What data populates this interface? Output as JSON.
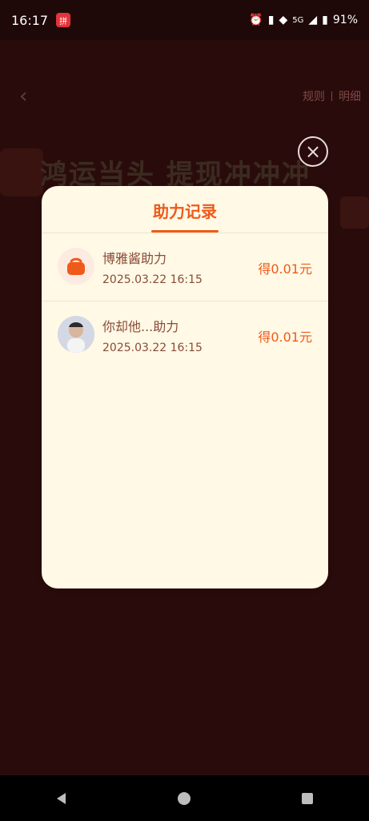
{
  "status_bar": {
    "time": "16:17",
    "network": "5G",
    "battery": "91%"
  },
  "background": {
    "header_links": {
      "rules": "规则",
      "details": "明细"
    },
    "banner_title": "鸿运当头 提现冲冲冲"
  },
  "modal": {
    "title": "助力记录",
    "records": [
      {
        "name": "博雅酱助力",
        "time": "2025.03.22 16:15",
        "amount": "得0.01元",
        "avatar": "bag"
      },
      {
        "name": "你却他...助力",
        "time": "2025.03.22 16:15",
        "amount": "得0.01元",
        "avatar": "person-photo"
      }
    ]
  },
  "colors": {
    "accent": "#ef5a1a",
    "modal_bg": "#fff9e6",
    "text_brown": "#8a4b35",
    "overlay_bg": "#2a0b0b"
  },
  "icons": {
    "back": "back-chevron-icon",
    "close": "close-icon",
    "nav_back": "nav-back-icon",
    "nav_home": "nav-home-icon",
    "nav_recent": "nav-recent-icon",
    "alarm": "alarm-icon",
    "wifi": "wifi-icon",
    "signal": "signal-icon",
    "battery": "battery-icon"
  }
}
